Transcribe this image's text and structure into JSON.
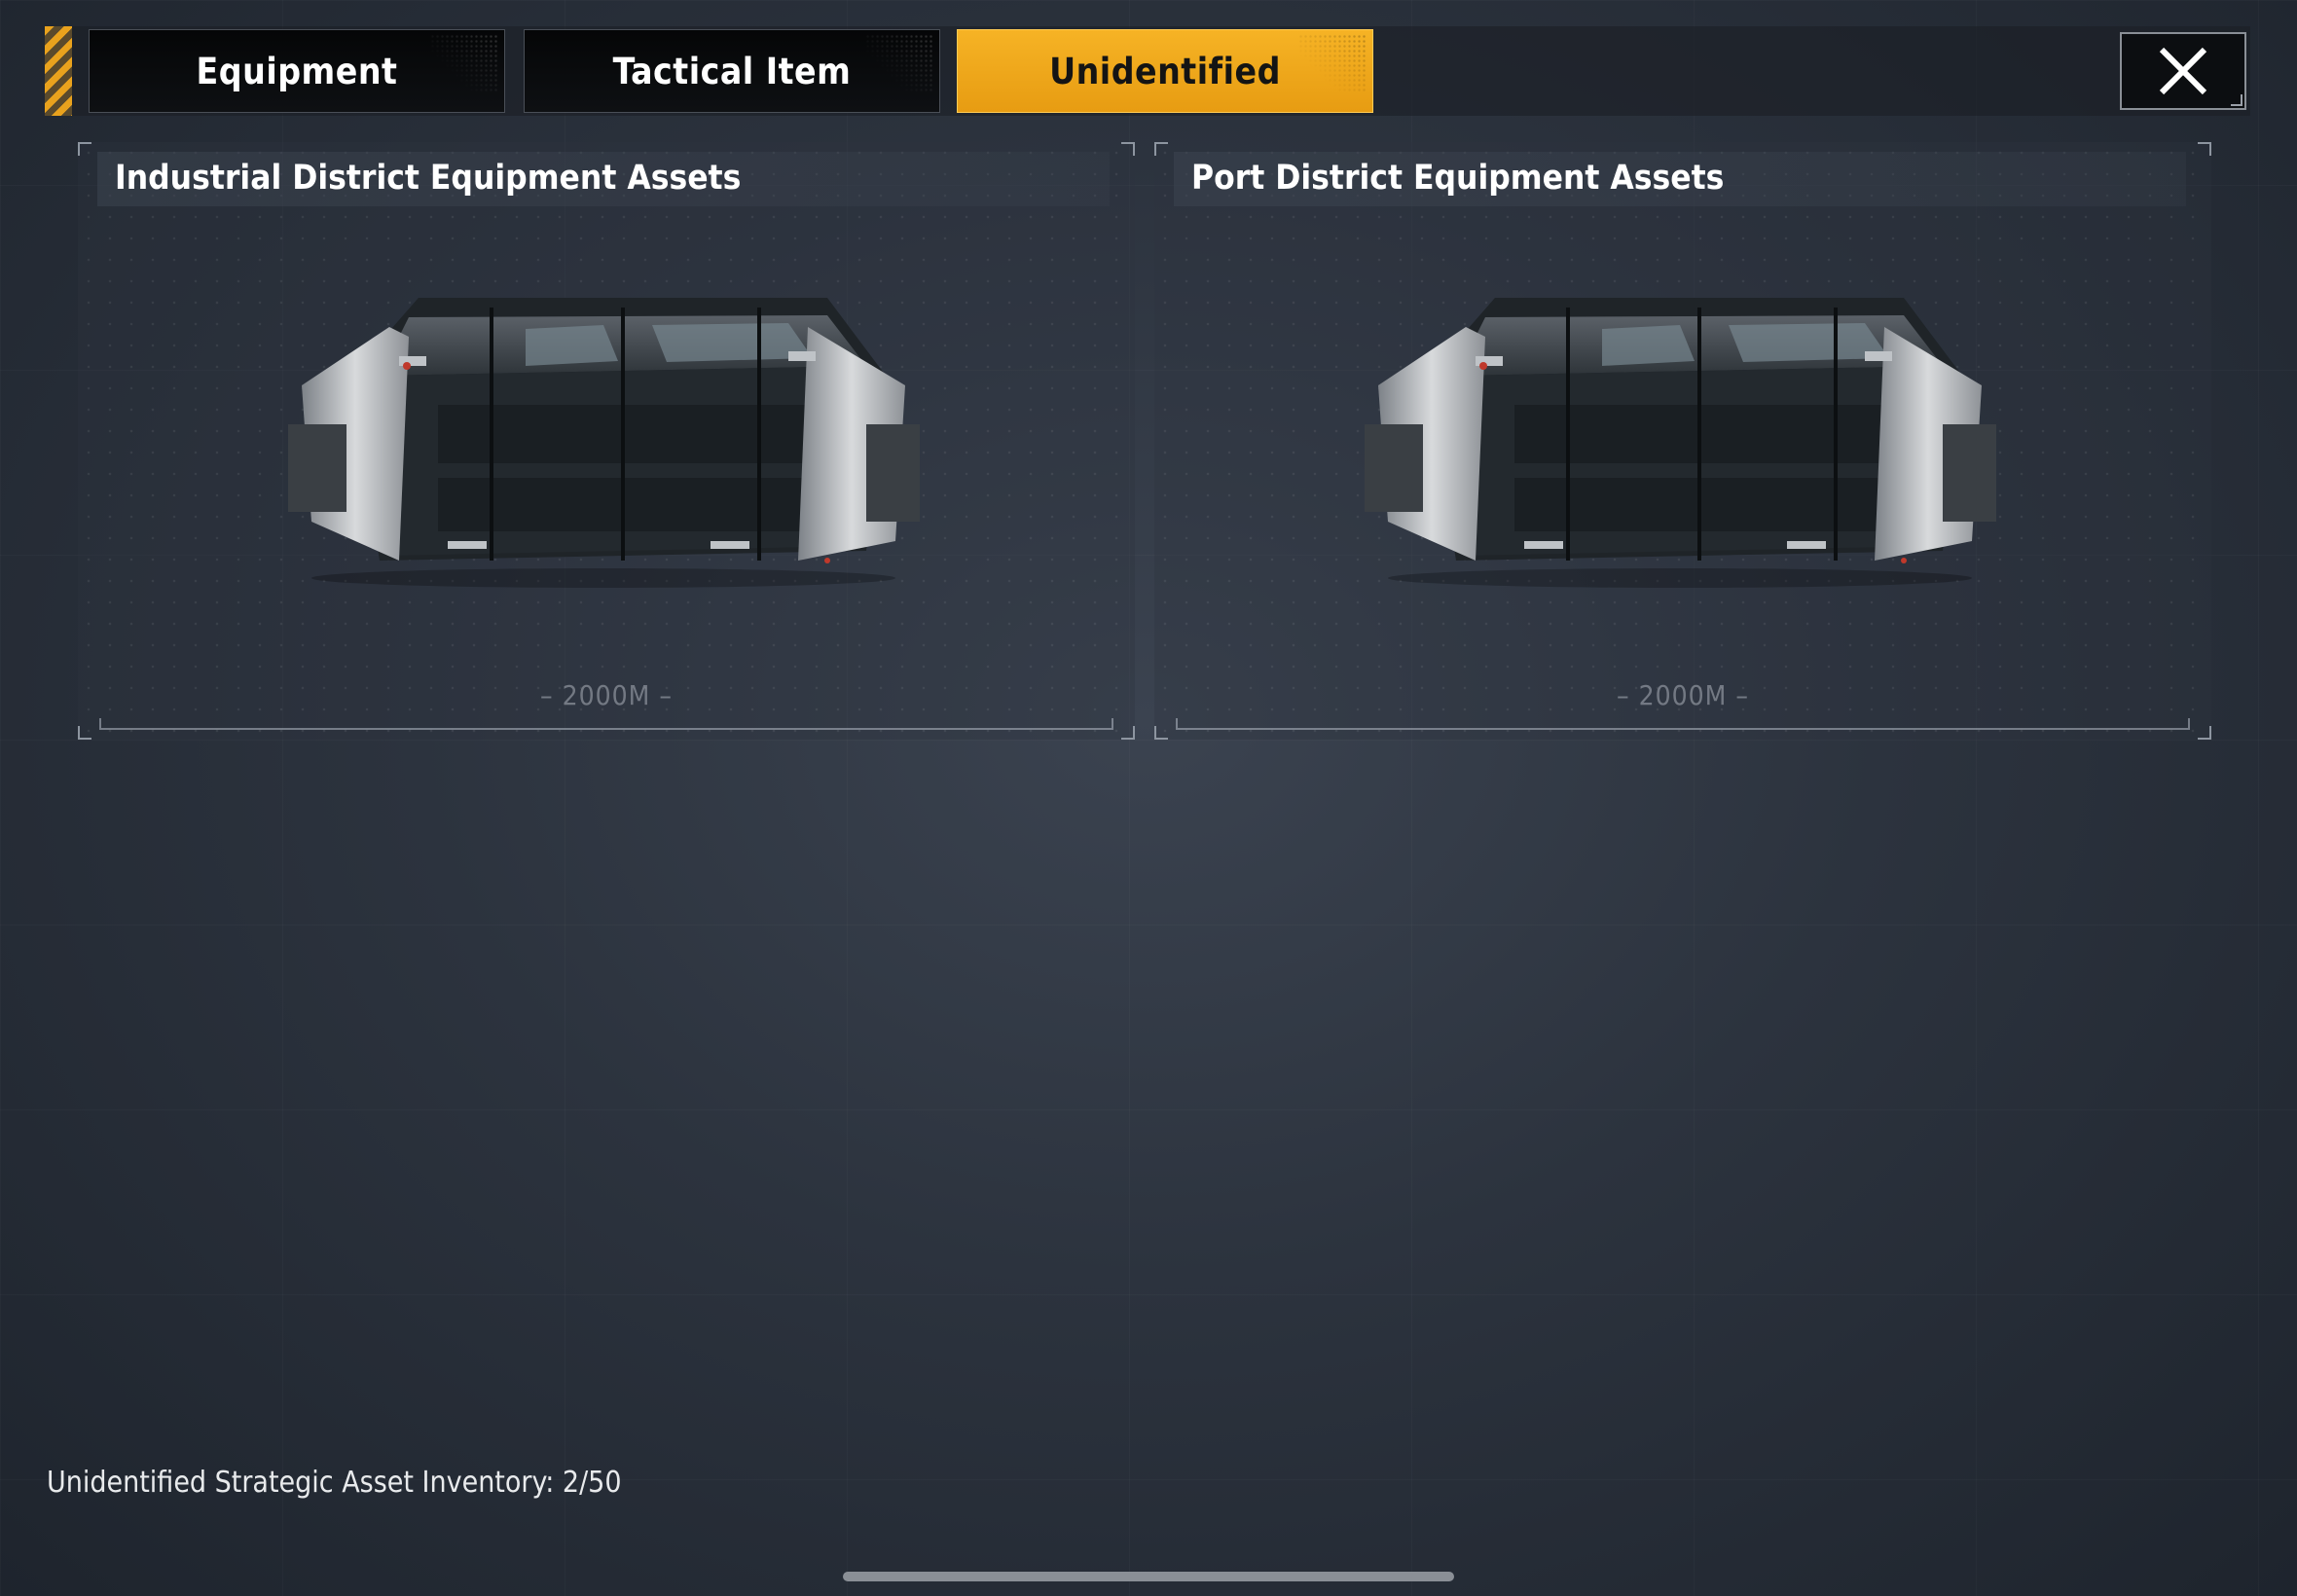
{
  "tabs": [
    {
      "label": "Equipment",
      "active": false
    },
    {
      "label": "Tactical Item",
      "active": false
    },
    {
      "label": "Unidentified",
      "active": true
    }
  ],
  "close_icon": "close-icon",
  "cards": [
    {
      "title": "Industrial District Equipment Assets",
      "distance": "2000M",
      "image": "supply-crate-icon"
    },
    {
      "title": "Port District Equipment Assets",
      "distance": "2000M",
      "image": "supply-crate-icon"
    }
  ],
  "footer": {
    "inventory_text": "Unidentified Strategic Asset Inventory: 2/50"
  },
  "colors": {
    "accent": "#f0a91c",
    "background": "#2c333e",
    "tab_inactive": "#07080a"
  }
}
